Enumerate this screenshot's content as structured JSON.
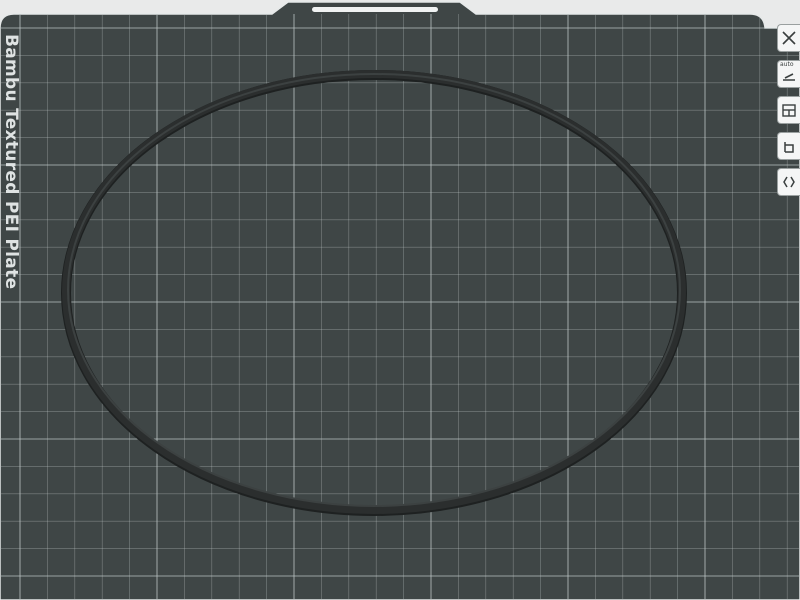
{
  "plate": {
    "label": "Bambu Textured PEI Plate",
    "surface_color": "#3f4646",
    "grid_color": "#b9c1c1",
    "background_color": "#e9eaea"
  },
  "model": {
    "shape": "ring",
    "color": "#2b2e2e"
  },
  "toolbar": {
    "items": [
      {
        "name": "close-icon"
      },
      {
        "name": "auto-orient-icon",
        "text": "auto"
      },
      {
        "name": "arrange-icon"
      },
      {
        "name": "lock-icon"
      },
      {
        "name": "settings-icon"
      }
    ]
  }
}
